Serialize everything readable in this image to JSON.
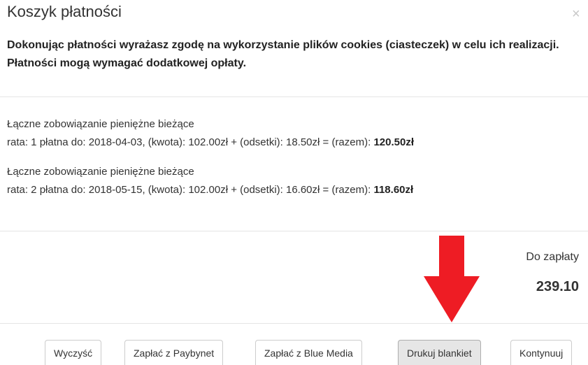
{
  "modal": {
    "title": "Koszyk płatności",
    "close_symbol": "×",
    "consent_text": "Dokonując płatności wyrażasz zgodę na wykorzystanie plików cookies (ciasteczek) w celu ich realizacji. Płatności mogą wymagać dodatkowej opłaty."
  },
  "obligations": [
    {
      "heading": "Łączne zobowiązanie pieniężne bieżące",
      "detail": "rata: 1 płatna do: 2018-04-03, (kwota): 102.00zł + (odsetki): 18.50zł = (razem): ",
      "total": "120.50zł"
    },
    {
      "heading": "Łączne zobowiązanie pieniężne bieżące",
      "detail": "rata: 2 płatna do: 2018-05-15, (kwota): 102.00zł + (odsetki): 16.60zł = (razem): ",
      "total": "118.60zł"
    }
  ],
  "summary": {
    "label": "Do zapłaty",
    "amount": "239.10"
  },
  "buttons": {
    "clear": "Wyczyść",
    "paybynet": "Zapłać z Paybynet",
    "bluemedia": "Zapłać z Blue Media",
    "print": "Drukuj blankiet",
    "continue": "Kontynuuj"
  },
  "colors": {
    "arrow": "#ee1c24",
    "active_button": "#e6e6e6"
  }
}
